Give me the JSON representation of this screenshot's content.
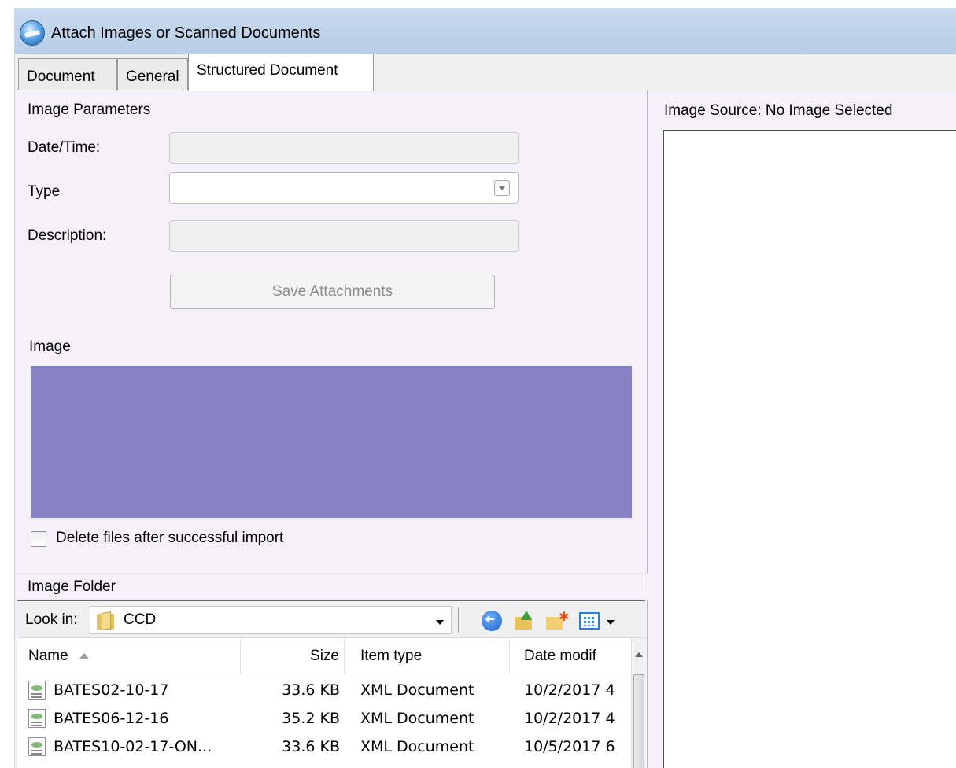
{
  "window": {
    "title": "Attach Images or Scanned Documents"
  },
  "tabs": [
    {
      "label": "Document",
      "active": false
    },
    {
      "label": "General",
      "active": false
    },
    {
      "label": "Structured Document",
      "active": true
    }
  ],
  "image_parameters": {
    "group_label": "Image Parameters",
    "date_time_label": "Date/Time:",
    "date_time_value": "",
    "type_label": "Type",
    "type_value": "",
    "description_label": "Description:",
    "description_value": "",
    "save_button": "Save Attachments"
  },
  "image": {
    "label": "Image",
    "color": "#8682c4"
  },
  "delete_option": {
    "label": "Delete files after successful import",
    "checked": false
  },
  "image_folder": {
    "label": "Image Folder",
    "look_in_label": "Look in:",
    "look_in_value": "CCD",
    "columns": [
      "Name",
      "Size",
      "Item type",
      "Date modif"
    ],
    "files": [
      {
        "name": "BATES02-10-17",
        "size": "33.6 KB",
        "type": "XML Document",
        "date": "10/2/2017 4"
      },
      {
        "name": "BATES06-12-16",
        "size": "35.2 KB",
        "type": "XML Document",
        "date": "10/2/2017 4"
      },
      {
        "name": "BATES10-02-17-ON...",
        "size": "33.6 KB",
        "type": "XML Document",
        "date": "10/5/2017 6"
      }
    ]
  },
  "image_source": {
    "label": "Image Source: No Image Selected"
  },
  "colors": {
    "titlebar": "#c1d5ec",
    "panel": "#f5f1f8",
    "image_swatch": "#8682c4"
  }
}
